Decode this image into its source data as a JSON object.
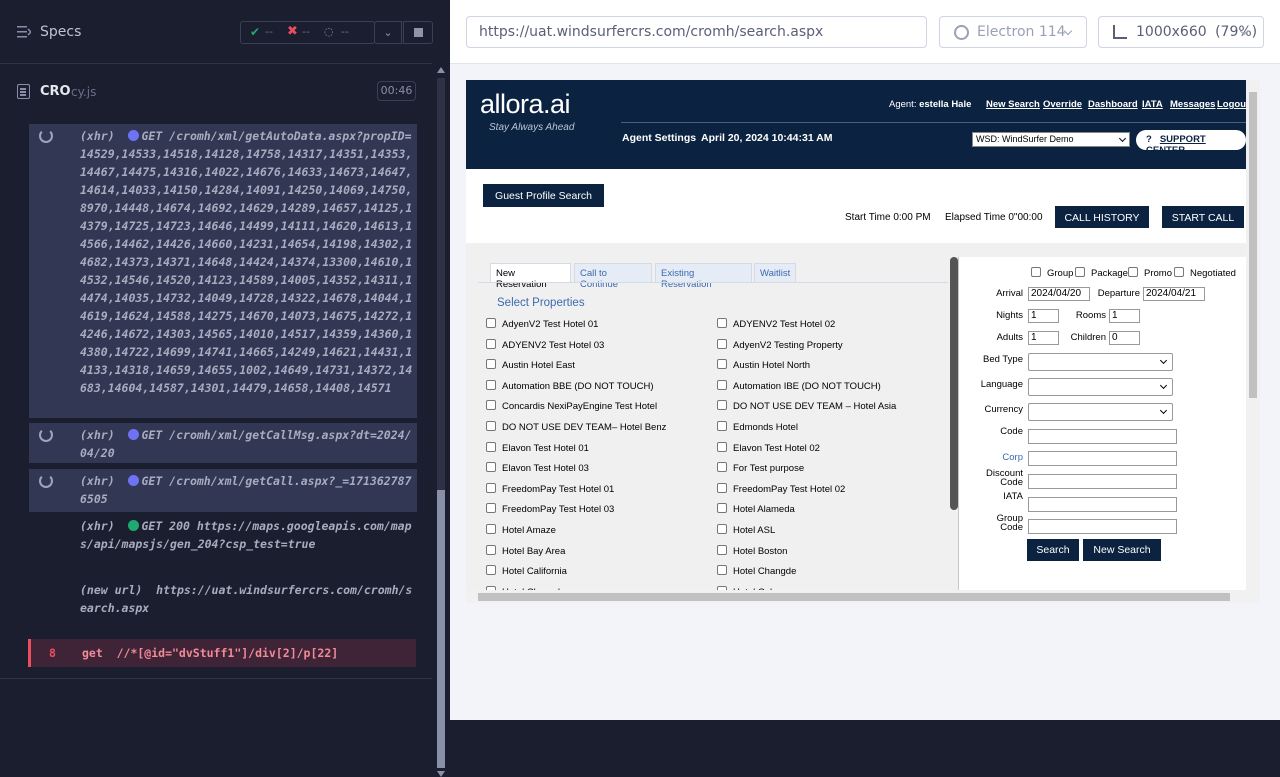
{
  "runner": {
    "specs_label": "Specs",
    "stats": {
      "passed": "--",
      "failed": "--",
      "pending": "--"
    },
    "spec_file": {
      "name": "CRO",
      "ext": "cy.js",
      "duration": "00:46"
    },
    "log": [
      {
        "kind": "pending",
        "method_text": "(xhr)",
        "dot_color": "#6e73f5",
        "text": "GET /cromh/xml/getAutoData.aspx?propID=14529,14533,14518,14128,14758,14317,14351,14353,14467,14475,14316,14022,14676,14633,14673,14647,14614,14033,14150,14284,14091,14250,14069,14750,8970,14448,14674,14692,14629,14289,14657,14125,14379,14725,14723,14646,14499,14111,14620,14613,14566,14462,14426,14660,14231,14654,14198,14302,14682,14373,14371,14648,14424,14374,13300,14610,14532,14546,14520,14123,14589,14005,14352,14311,14474,14035,14732,14049,14728,14322,14678,14044,14619,14624,14588,14275,14670,14073,14675,14272,14246,14672,14303,14565,14010,14517,14359,14360,14380,14722,14699,14741,14665,14249,14621,14431,14133,14318,14659,14655,1002,14649,14731,14372,14683,14604,14587,14301,14479,14658,14408,14571"
      },
      {
        "kind": "pending",
        "method_text": "(xhr)",
        "dot_color": "#6e73f5",
        "text": "GET /cromh/xml/getCallMsg.aspx?dt=2024/04/20"
      },
      {
        "kind": "pending",
        "method_text": "(xhr)",
        "dot_color": "#6e73f5",
        "text": "GET /cromh/xml/getCall.aspx?_=1713627876505"
      },
      {
        "kind": "done",
        "method_text": "(xhr)",
        "dot_color": "#1fa971",
        "text": "GET 200 https://maps.googleapis.com/maps/api/mapsjs/gen_204?csp_test=true"
      },
      {
        "kind": "done",
        "method_text": "(new url)",
        "text": "https://uat.windsurfercrs.com/cromh/search.aspx"
      },
      {
        "kind": "failed",
        "num": "8",
        "text": "get  //*[@id=\"dvStuff1\"]/div[2]/p[22]"
      }
    ]
  },
  "browser": {
    "url": "https://uat.windsurfercrs.com/cromh/search.aspx",
    "engine": "Electron 114",
    "viewport": "1000x660",
    "zoom": "(79%)"
  },
  "app": {
    "logo": "allora.ai",
    "tagline": "Stay Always Ahead",
    "agent_label": "Agent:",
    "agent_name": "estella Hale",
    "nav": [
      "New Search",
      "Override",
      "Dashboard",
      "IATA",
      "Messages",
      "Logout"
    ],
    "agent_settings": "Agent Settings",
    "datetime": "April 20, 2024 10:44:31 AM",
    "site": "WSD: WindSurfer Demo",
    "support": "SUPPORT CENTER",
    "guest_profile": "Guest Profile Search",
    "start_time": "Start Time 0:00 PM",
    "elapsed_time": "Elapsed Time 0\"00:00",
    "call_history": "CALL HISTORY",
    "start_call": "START CALL",
    "tabs": [
      "New Reservation",
      "Call to Continue",
      "Existing Reservation",
      "Waitlist"
    ],
    "select_properties": "Select Properties",
    "properties_col1": [
      "AdyenV2 Test Hotel 01",
      "ADYENV2 Test Hotel 03",
      "Austin Hotel East",
      "Automation BBE (DO NOT TOUCH)",
      "Concardis NexiPayEngine Test Hotel",
      "DO NOT USE DEV TEAM– Hotel Benz",
      "Elavon Test Hotel 01",
      "Elavon Test Hotel 03",
      "FreedomPay Test Hotel 01",
      "FreedomPay Test Hotel 03",
      "Hotel Amaze",
      "Hotel Bay Area",
      "Hotel California",
      "Hotel Chengdu"
    ],
    "properties_col2": [
      "ADYENV2 Test Hotel 02",
      "AdyenV2 Testing Property",
      "Austin Hotel North",
      "Automation IBE (DO NOT TOUCH)",
      "DO NOT USE DEV TEAM – Hotel Asia",
      "Edmonds Hotel",
      "Elavon Test Hotel 02",
      "For Test purpose",
      "FreedomPay Test Hotel 02",
      "Hotel Alameda",
      "Hotel ASL",
      "Hotel Boston",
      "Hotel Changde",
      "Hotel Color"
    ],
    "search": {
      "checkboxes": [
        "Group",
        "Package",
        "Promo",
        "Negotiated"
      ],
      "arrival_label": "Arrival",
      "arrival": "2024/04/20",
      "departure_label": "Departure",
      "departure": "2024/04/21",
      "nights_label": "Nights",
      "nights": "1",
      "rooms_label": "Rooms",
      "rooms": "1",
      "adults_label": "Adults",
      "adults": "1",
      "children_label": "Children",
      "children": "0",
      "bed_type_label": "Bed Type",
      "language_label": "Language",
      "currency_label": "Currency",
      "code_label": "Code",
      "corp_label": "Corp",
      "discount_code_label_1": "Discount",
      "discount_code_label_2": "Code",
      "iata_label": "IATA",
      "group_code_label_1": "Group",
      "group_code_label_2": "Code",
      "search_btn": "Search",
      "new_search_btn": "New Search"
    }
  }
}
